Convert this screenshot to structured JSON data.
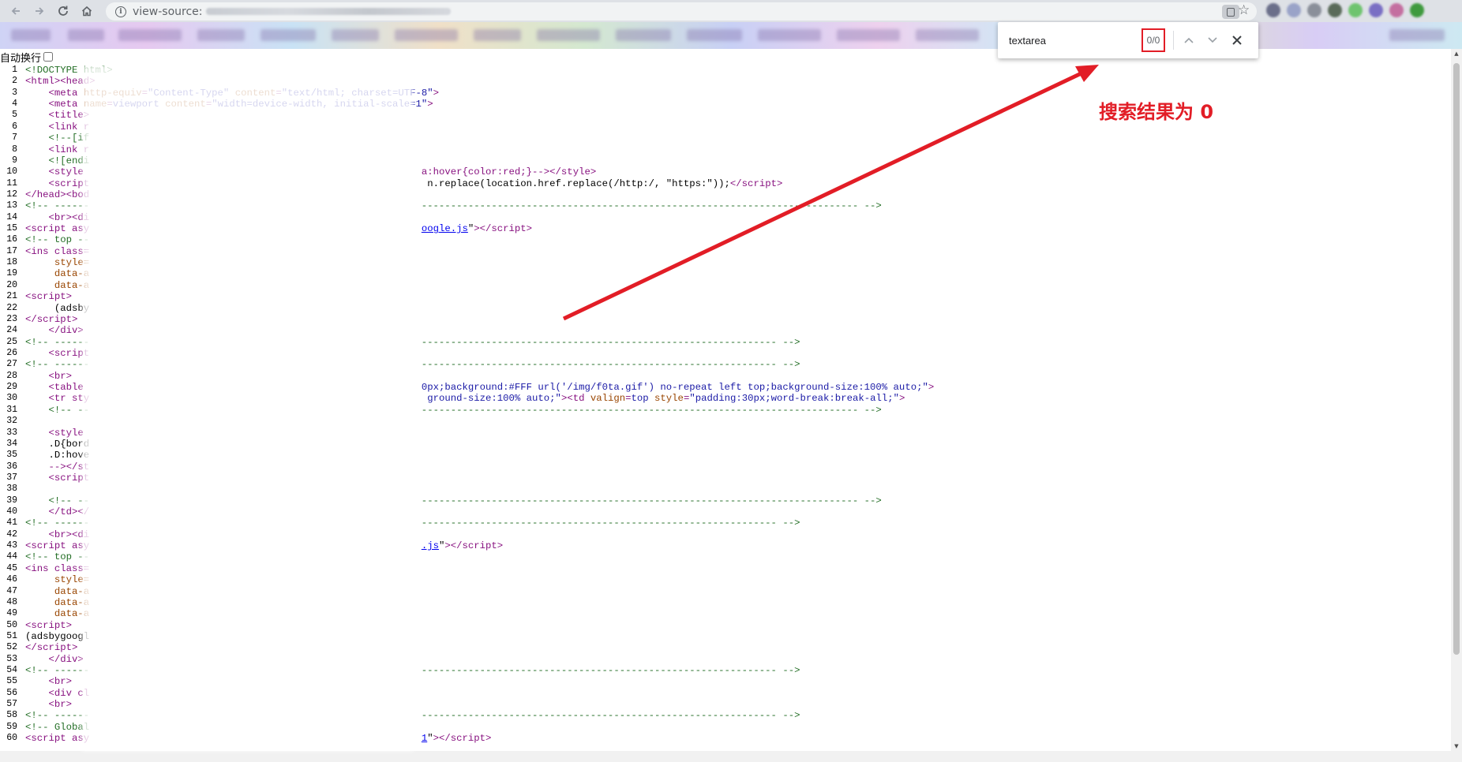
{
  "browser": {
    "url_prefix": "view-source:",
    "back_icon": "arrow-left-icon",
    "forward_icon": "arrow-right-icon",
    "reload_icon": "reload-icon",
    "home_icon": "home-icon",
    "star_icon": "star-icon"
  },
  "find": {
    "query": "textarea",
    "count": "0/0",
    "prev_icon": "chevron-up-icon",
    "next_icon": "chevron-down-icon",
    "close_icon": "close-icon"
  },
  "wrap_label": "自动换行",
  "annotation": {
    "text": "搜索结果为 0",
    "color": "#e21d26"
  },
  "source_lines": [
    [
      "1",
      "<span class=\"c\">&lt;!DOCTYPE html&gt;</span>"
    ],
    [
      "2",
      "<span class=\"t\">&lt;html&gt;&lt;head&gt;</span>"
    ],
    [
      "3",
      "    <span class=\"t\">&lt;meta </span><span class=\"a\">http-equiv</span><span class=\"t\">=</span><span class=\"v\">\"Content-Type\"</span><span class=\"a\"> content</span><span class=\"t\">=</span><span class=\"v\">\"text/html; charset=UTF-8\"</span><span class=\"t\">&gt;</span>"
    ],
    [
      "4",
      "    <span class=\"t\">&lt;meta </span><span class=\"a\">name</span><span class=\"t\">=</span><span class=\"v\">viewport</span><span class=\"a\"> content</span><span class=\"t\">=</span><span class=\"v\">\"width=device-width, initial-scale=1\"</span><span class=\"t\">&gt;</span>"
    ],
    [
      "5",
      "    <span class=\"t\">&lt;title&gt;</span>"
    ],
    [
      "6",
      "    <span class=\"t\">&lt;link r</span>"
    ],
    [
      "7",
      "    <span class=\"c\">&lt;!--[if</span>"
    ],
    [
      "8",
      "    <span class=\"t\">&lt;link r</span>"
    ],
    [
      "9",
      "    <span class=\"c\">&lt;![endi</span>"
    ],
    [
      "10",
      "    <span class=\"t\">&lt;style</span>                                                          <span class=\"t\">a:hover{color:red;}--&gt;&lt;/style&gt;</span>"
    ],
    [
      "11",
      "    <span class=\"t\">&lt;script</span>                                                          n.replace(location.href.replace(/http:/, \"https:\"));<span class=\"t\">&lt;/script&gt;</span>"
    ],
    [
      "12",
      "<span class=\"t\">&lt;/head&gt;&lt;bod</span>"
    ],
    [
      "13",
      "<span class=\"c\">&lt;!-- ------                                                         --------------------------------------------------------------------------- --&gt;</span>"
    ],
    [
      "14",
      "    <span class=\"t\">&lt;br&gt;&lt;di</span>"
    ],
    [
      "15",
      "<span class=\"t\">&lt;script asy</span>                                                         <span class=\"l\">oogle.js</span>\"<span class=\"t\">&gt;&lt;/script&gt;</span>"
    ],
    [
      "16",
      "<span class=\"c\">&lt;!-- top --</span>"
    ],
    [
      "17",
      "<span class=\"t\">&lt;ins class=</span>"
    ],
    [
      "18",
      "     <span class=\"a\">style=</span>"
    ],
    [
      "19",
      "     <span class=\"a\">data-a</span>"
    ],
    [
      "20",
      "     <span class=\"a\">data-a</span>"
    ],
    [
      "21",
      "<span class=\"t\">&lt;script&gt;</span>"
    ],
    [
      "22",
      "     (adsby"
    ],
    [
      "23",
      "<span class=\"t\">&lt;/script&gt;</span>"
    ],
    [
      "24",
      "    <span class=\"t\">&lt;/div&gt;</span>"
    ],
    [
      "25",
      "<span class=\"c\">&lt;!-- ------                                                         ------------------------------------------------------------- --&gt;</span>"
    ],
    [
      "26",
      "    <span class=\"t\">&lt;script</span>"
    ],
    [
      "27",
      "<span class=\"c\">&lt;!-- ------                                                         ------------------------------------------------------------- --&gt;</span>"
    ],
    [
      "28",
      "    <span class=\"t\">&lt;br&gt;</span>"
    ],
    [
      "29",
      "    <span class=\"t\">&lt;table</span>                                                          <span class=\"v\">0px;background:#FFF url('/img/f0ta.gif') no-repeat left top;background-size:100% auto;\"</span><span class=\"t\">&gt;</span>"
    ],
    [
      "30",
      "    <span class=\"t\">&lt;tr sty</span>                                                          <span class=\"v\">ground-size:100% auto;\"</span><span class=\"t\">&gt;&lt;td </span><span class=\"a\">valign</span><span class=\"t\">=</span><span class=\"v\">top</span><span class=\"a\"> style</span><span class=\"t\">=</span><span class=\"v\">\"padding:30px;word-break:break-all;\"</span><span class=\"t\">&gt;</span>"
    ],
    [
      "31",
      "    <span class=\"c\">&lt;!-- --                                                         --------------------------------------------------------------------------- --&gt;</span>"
    ],
    [
      "32",
      ""
    ],
    [
      "33",
      "    <span class=\"t\">&lt;style</span>"
    ],
    [
      "34",
      "    .D{bord"
    ],
    [
      "35",
      "    .D:hove"
    ],
    [
      "36",
      "    <span class=\"t\">--&gt;&lt;/st</span>"
    ],
    [
      "37",
      "    <span class=\"t\">&lt;script</span>"
    ],
    [
      "38",
      ""
    ],
    [
      "39",
      "    <span class=\"c\">&lt;!-- --                                                         --------------------------------------------------------------------------- --&gt;</span>"
    ],
    [
      "40",
      "    <span class=\"t\">&lt;/td&gt;&lt;/</span>"
    ],
    [
      "41",
      "<span class=\"c\">&lt;!-- ------                                                         ------------------------------------------------------------- --&gt;</span>"
    ],
    [
      "42",
      "    <span class=\"t\">&lt;br&gt;&lt;di</span>"
    ],
    [
      "43",
      "<span class=\"t\">&lt;script asy</span>                                                         <span class=\"l\">.js</span>\"<span class=\"t\">&gt;&lt;/script&gt;</span>"
    ],
    [
      "44",
      "<span class=\"c\">&lt;!-- top --</span>"
    ],
    [
      "45",
      "<span class=\"t\">&lt;ins class=</span>"
    ],
    [
      "46",
      "     <span class=\"a\">style=</span>"
    ],
    [
      "47",
      "     <span class=\"a\">data-a</span>"
    ],
    [
      "48",
      "     <span class=\"a\">data-a</span>"
    ],
    [
      "49",
      "     <span class=\"a\">data-a</span>"
    ],
    [
      "50",
      "<span class=\"t\">&lt;script&gt;</span>"
    ],
    [
      "51",
      "(adsbygoogl"
    ],
    [
      "52",
      "<span class=\"t\">&lt;/script&gt;</span>"
    ],
    [
      "53",
      "    <span class=\"t\">&lt;/div&gt;</span>"
    ],
    [
      "54",
      "<span class=\"c\">&lt;!-- ------                                                         ------------------------------------------------------------- --&gt;</span>"
    ],
    [
      "55",
      "    <span class=\"t\">&lt;br&gt;</span>"
    ],
    [
      "56",
      "    <span class=\"t\">&lt;div cl</span>"
    ],
    [
      "57",
      "    <span class=\"t\">&lt;br&gt;</span>"
    ],
    [
      "58",
      "<span class=\"c\">&lt;!-- ------                                                         ------------------------------------------------------------- --&gt;</span>"
    ],
    [
      "59",
      "<span class=\"c\">&lt;!-- Global</span>"
    ],
    [
      "60",
      "<span class=\"t\">&lt;script asy</span>                                                         <span class=\"l\">1</span>\"<span class=\"t\">&gt;&lt;/script&gt;</span>"
    ]
  ]
}
